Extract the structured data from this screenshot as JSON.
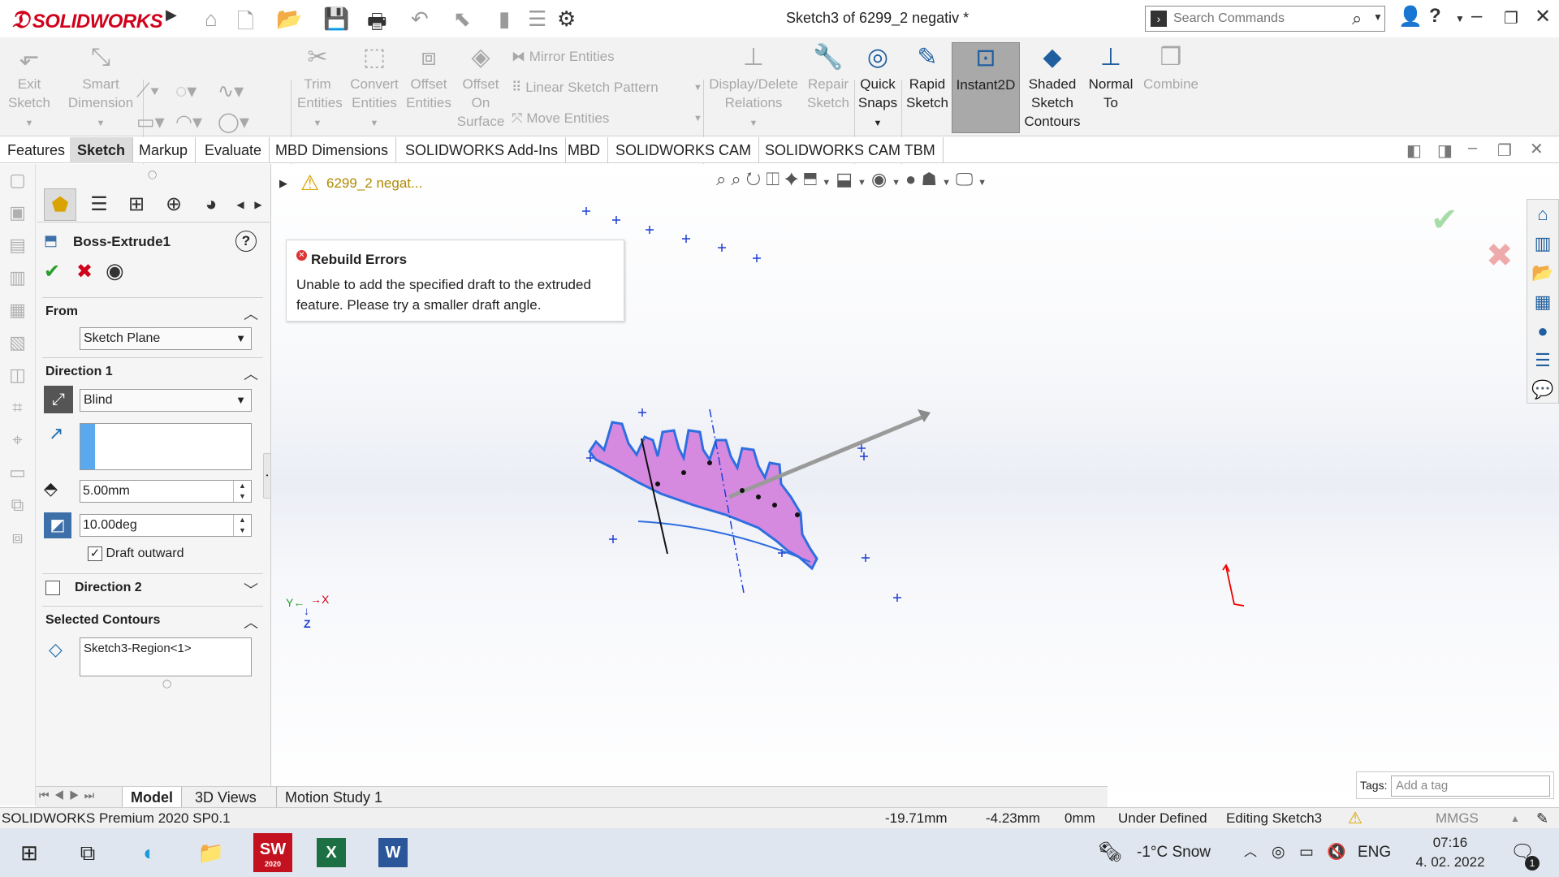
{
  "app": {
    "logo": "SOLIDWORKS",
    "window_title": "Sketch3 of 6299_2 negativ *"
  },
  "search": {
    "placeholder": "Search Commands"
  },
  "commands": {
    "exit_sketch": [
      "Exit",
      "Sketch"
    ],
    "smart_dimension": [
      "Smart",
      "Dimension"
    ],
    "trim": [
      "Trim",
      "Entities"
    ],
    "convert": [
      "Convert",
      "Entities"
    ],
    "offset": [
      "Offset",
      "Entities"
    ],
    "offset_surface": [
      "Offset",
      "On",
      "Surface"
    ],
    "mirror": "Mirror Entities",
    "linear_pattern": "Linear Sketch Pattern",
    "move": "Move Entities",
    "display_delete": [
      "Display/Delete",
      "Relations"
    ],
    "repair": [
      "Repair",
      "Sketch"
    ],
    "quick_snaps": [
      "Quick",
      "Snaps"
    ],
    "rapid": [
      "Rapid",
      "Sketch"
    ],
    "instant2d": "Instant2D",
    "shaded": [
      "Shaded",
      "Sketch",
      "Contours"
    ],
    "normal_to": [
      "Normal",
      "To"
    ],
    "combine": "Combine"
  },
  "tabs": [
    "Features",
    "Sketch",
    "Markup",
    "Evaluate",
    "MBD Dimensions",
    "SOLIDWORKS Add-Ins",
    "MBD",
    "SOLIDWORKS CAM",
    "SOLIDWORKS CAM TBM"
  ],
  "tree": {
    "root": "6299_2 negat..."
  },
  "pm": {
    "title": "Boss-Extrude1",
    "from": {
      "label": "From",
      "value": "Sketch Plane"
    },
    "dir1": {
      "label": "Direction 1",
      "type": "Blind",
      "depth": "5.00mm",
      "draft": "10.00deg",
      "draft_outward": "Draft outward"
    },
    "dir2": {
      "label": "Direction 2"
    },
    "contours": {
      "label": "Selected Contours",
      "value": "Sketch3-Region<1>"
    }
  },
  "error": {
    "title": "Rebuild Errors",
    "message": "Unable to add the specified draft to the extruded feature.  Please try a smaller draft angle."
  },
  "bottom_tabs": [
    "Model",
    "3D Views",
    "Motion Study 1"
  ],
  "tags": {
    "label": "Tags:",
    "placeholder": "Add a tag"
  },
  "status": {
    "product": "SOLIDWORKS Premium 2020 SP0.1",
    "x": "-19.71mm",
    "y": "-4.23mm",
    "z": "0mm",
    "state": "Under Defined",
    "mode": "Editing Sketch3",
    "units": "MMGS"
  },
  "taskbar": {
    "weather": "-1°C  Snow",
    "lang": "ENG",
    "time": "07:16",
    "date": "4. 02. 2022",
    "notif": "1",
    "sw_badge": "2020"
  }
}
